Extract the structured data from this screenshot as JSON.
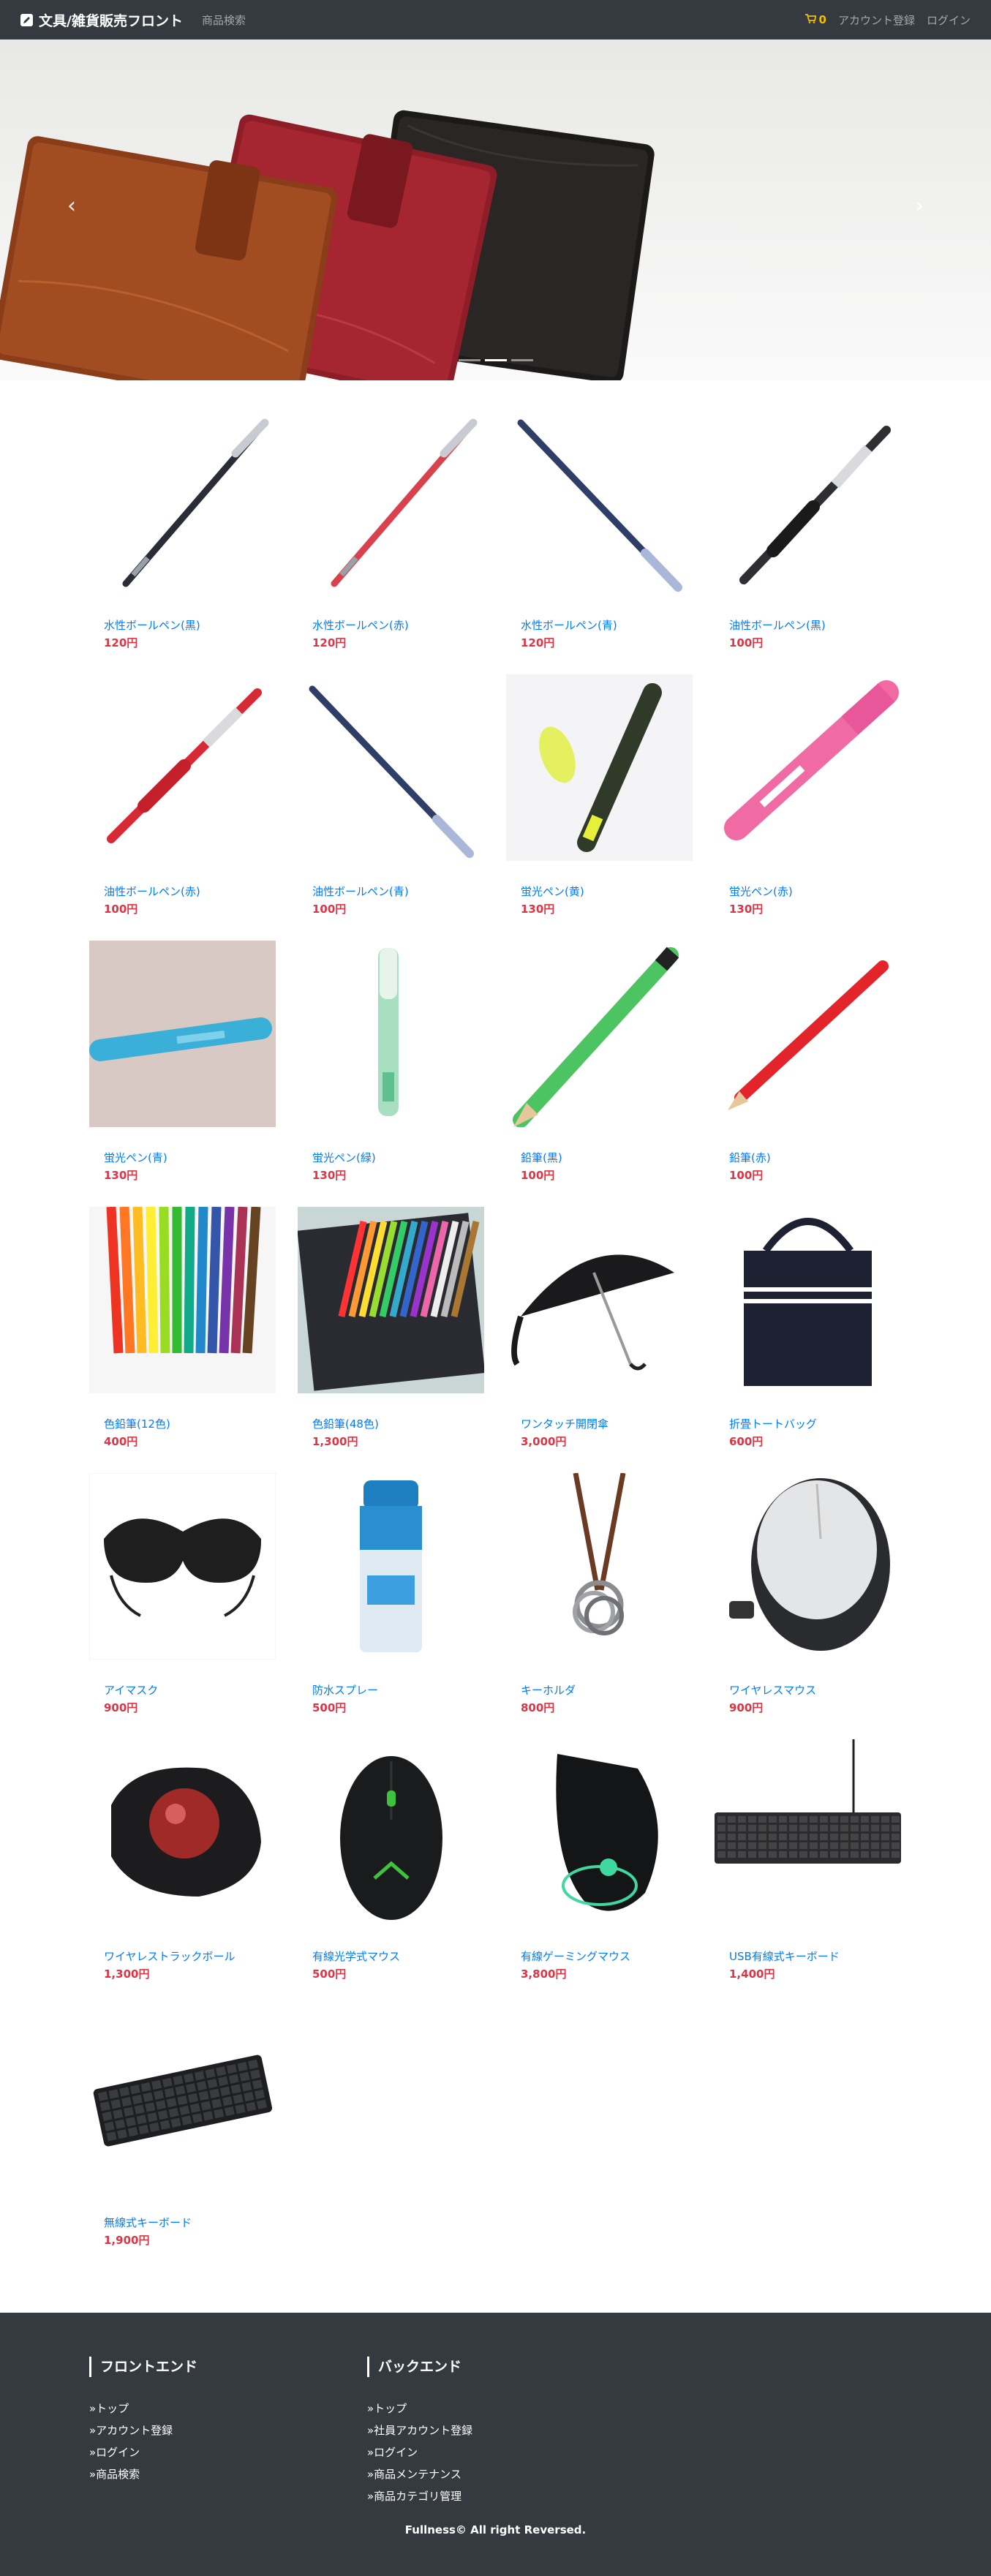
{
  "navbar": {
    "brand": "文具/雑貨販売フロント",
    "search_link": "商品検索",
    "cart_count": "0",
    "register_link": "アカウント登録",
    "login_link": "ログイン"
  },
  "carousel": {
    "prev_glyph": "‹",
    "next_glyph": "›",
    "slide_count": 3,
    "active_slide": 1
  },
  "products": [
    {
      "name": "水性ボールペン(黒)",
      "price": "120円",
      "image": "black-pen"
    },
    {
      "name": "水性ボールペン(赤)",
      "price": "120円",
      "image": "red-pen"
    },
    {
      "name": "水性ボールペン(青)",
      "price": "120円",
      "image": "blue-pen"
    },
    {
      "name": "油性ボールペン(黒)",
      "price": "100円",
      "image": "black-click-pen"
    },
    {
      "name": "油性ボールペン(赤)",
      "price": "100円",
      "image": "red-click-pen"
    },
    {
      "name": "油性ボールペン(青)",
      "price": "100円",
      "image": "blue-pen"
    },
    {
      "name": "蛍光ペン(黄)",
      "price": "130円",
      "image": "yellow-highlighter"
    },
    {
      "name": "蛍光ペン(赤)",
      "price": "130円",
      "image": "pink-highlighter"
    },
    {
      "name": "蛍光ペン(青)",
      "price": "130円",
      "image": "blue-highlighter"
    },
    {
      "name": "蛍光ペン(緑)",
      "price": "130円",
      "image": "green-highlighter"
    },
    {
      "name": "鉛筆(黒)",
      "price": "100円",
      "image": "green-pencil"
    },
    {
      "name": "鉛筆(赤)",
      "price": "100円",
      "image": "red-pencil"
    },
    {
      "name": "色鉛筆(12色)",
      "price": "400円",
      "image": "colored-pencils-12"
    },
    {
      "name": "色鉛筆(48色)",
      "price": "1,300円",
      "image": "colored-pencils-48"
    },
    {
      "name": "ワンタッチ開閉傘",
      "price": "3,000円",
      "image": "umbrella"
    },
    {
      "name": "折畳トートバッグ",
      "price": "600円",
      "image": "tote-bag"
    },
    {
      "name": "アイマスク",
      "price": "900円",
      "image": "eye-mask"
    },
    {
      "name": "防水スプレー",
      "price": "500円",
      "image": "spray-can"
    },
    {
      "name": "キーホルダ",
      "price": "800円",
      "image": "key-holder"
    },
    {
      "name": "ワイヤレスマウス",
      "price": "900円",
      "image": "wireless-mouse"
    },
    {
      "name": "ワイヤレストラックボール",
      "price": "1,300円",
      "image": "trackball"
    },
    {
      "name": "有線光学式マウス",
      "price": "500円",
      "image": "wired-mouse"
    },
    {
      "name": "有線ゲーミングマウス",
      "price": "3,800円",
      "image": "gaming-mouse"
    },
    {
      "name": "USB有線式キーボード",
      "price": "1,400円",
      "image": "usb-keyboard"
    },
    {
      "name": "無線式キーボード",
      "price": "1,900円",
      "image": "wireless-keyboard"
    }
  ],
  "footer": {
    "frontend": {
      "heading": "フロントエンド",
      "links": [
        "»トップ",
        "»アカウント登録",
        "»ログイン",
        "»商品検索"
      ]
    },
    "backend": {
      "heading": "バックエンド",
      "links": [
        "»トップ",
        "»社員アカウント登録",
        "»ログイン",
        "»商品メンテナンス",
        "»商品カテゴリ管理"
      ]
    },
    "copyright": "Fullness© All right Reversed."
  },
  "colors": {
    "navbar_bg": "#343a40",
    "link_blue": "#007bff",
    "price_red": "#dc3545",
    "cart_yellow": "#f0c000"
  }
}
